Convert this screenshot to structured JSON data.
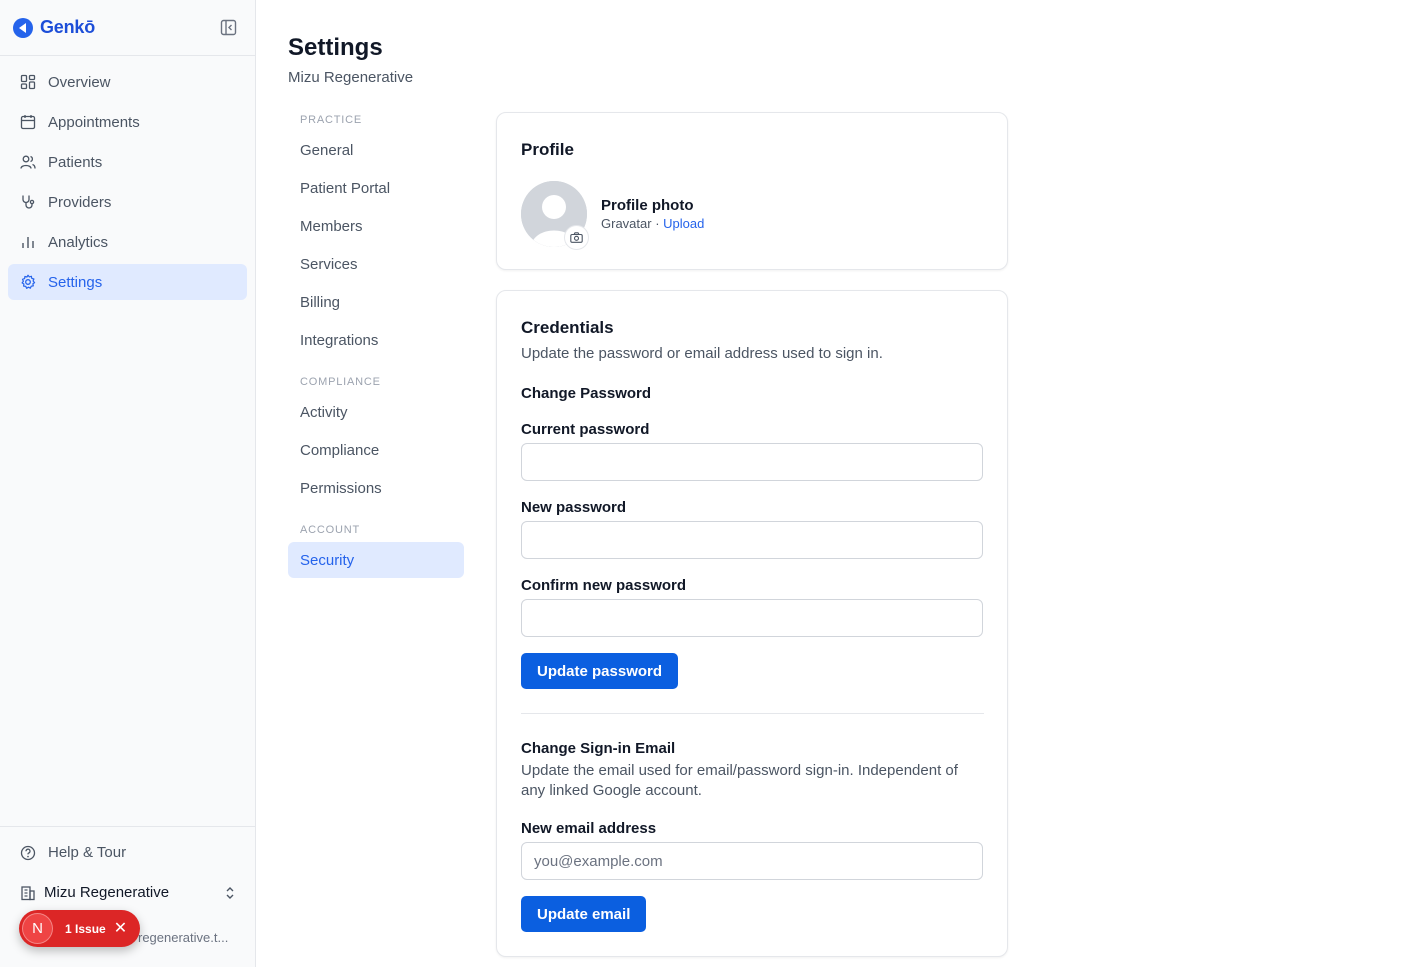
{
  "app": {
    "name": "Genkō",
    "accent": "#2563eb",
    "button_color": "#0b5fe0"
  },
  "sidebar": {
    "items": [
      {
        "label": "Overview",
        "icon": "grid-icon"
      },
      {
        "label": "Appointments",
        "icon": "calendar-icon"
      },
      {
        "label": "Patients",
        "icon": "users-icon"
      },
      {
        "label": "Providers",
        "icon": "stethoscope-icon"
      },
      {
        "label": "Analytics",
        "icon": "bar-chart-icon"
      },
      {
        "label": "Settings",
        "icon": "gear-icon",
        "active": true
      }
    ],
    "help_label": "Help & Tour",
    "org_name": "Mizu Regenerative",
    "user_email_visible": "regenerative.t..."
  },
  "issue_badge": {
    "letter": "N",
    "text": "1 Issue",
    "close": "✕"
  },
  "header": {
    "title": "Settings",
    "subtitle": "Mizu Regenerative"
  },
  "settings_nav": {
    "practice_label": "PRACTICE",
    "practice": [
      "General",
      "Patient Portal",
      "Members",
      "Services",
      "Billing",
      "Integrations"
    ],
    "compliance_label": "COMPLIANCE",
    "compliance": [
      "Activity",
      "Compliance",
      "Permissions"
    ],
    "account_label": "ACCOUNT",
    "account": [
      "Security"
    ]
  },
  "profile": {
    "title": "Profile",
    "photo_title": "Profile photo",
    "source": "Gravatar",
    "separator": " · ",
    "upload_label": "Upload"
  },
  "credentials": {
    "title": "Credentials",
    "description": "Update the password or email address used to sign in.",
    "change_password_heading": "Change Password",
    "current_password_label": "Current password",
    "new_password_label": "New password",
    "confirm_password_label": "Confirm new password",
    "update_password_button": "Update password",
    "change_email_heading": "Change Sign-in Email",
    "change_email_description": "Update the email used for email/password sign-in. Independent of any linked Google account.",
    "new_email_label": "New email address",
    "new_email_placeholder": "you@example.com",
    "update_email_button": "Update email"
  }
}
